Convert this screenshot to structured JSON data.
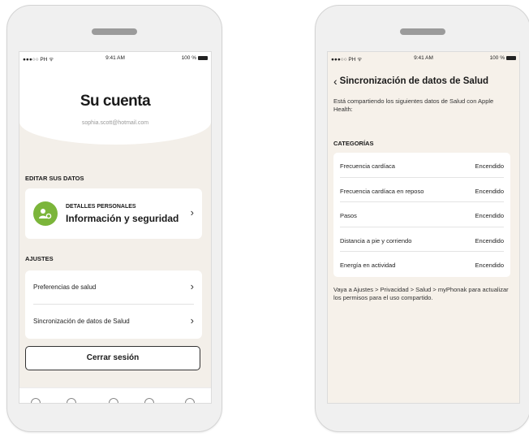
{
  "left_screen": {
    "status": {
      "carrier": "●●●○○ PH ᯤ",
      "time": "9:41 AM",
      "battery": "100 %"
    },
    "title": "Su cuenta",
    "email": "sophia.scott@hotmail.com",
    "edit_section_label": "EDITAR SUS DATOS",
    "personal_card": {
      "small_label": "DETALLES PERSONALES",
      "big_label": "Información y seguridad"
    },
    "settings_section_label": "AJUSTES",
    "settings_items": [
      {
        "label": "Preferencias de salud"
      },
      {
        "label": "Sincronización de datos de Salud"
      }
    ],
    "logout_label": "Cerrar sesión"
  },
  "right_screen": {
    "status": {
      "carrier": "●●●○○ PH ᯤ",
      "time": "9:41 AM",
      "battery": "100 %"
    },
    "title": "Sincronización de datos de Salud",
    "intro": "Está compartiendo los siguientes datos de Salud con Apple Health:",
    "categories_label": "CATEGORÍAS",
    "categories": [
      {
        "name": "Frecuencia cardíaca",
        "status": "Encendido"
      },
      {
        "name": "Frecuencia cardíaca en reposo",
        "status": "Encendido"
      },
      {
        "name": "Pasos",
        "status": "Encendido"
      },
      {
        "name": "Distancia a pie y corriendo",
        "status": "Encendido"
      },
      {
        "name": "Energía en actividad",
        "status": "Encendido"
      }
    ],
    "footer_note": "Vaya a Ajustes > Privacidad > Salud > myPhonak para actualizar los permisos para el uso compartido."
  },
  "icons": {
    "chevron": "chevron-right-icon",
    "back": "chevron-left-icon",
    "avatar": "user-settings-icon"
  },
  "colors": {
    "accent_green": "#7bb53a",
    "screen_bg": "#f3efe9"
  }
}
